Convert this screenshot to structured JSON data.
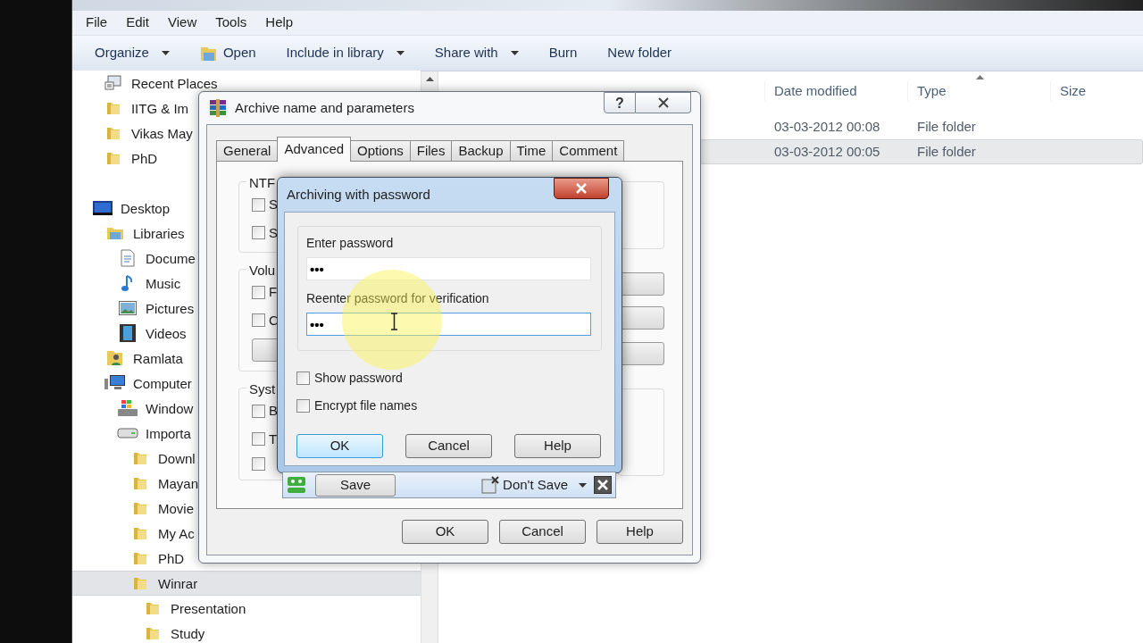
{
  "menu": [
    "File",
    "Edit",
    "View",
    "Tools",
    "Help"
  ],
  "toolbar": [
    {
      "label": "Organize",
      "kind": "dropdown"
    },
    {
      "label": "Open",
      "kind": "icon"
    },
    {
      "label": "Include in library",
      "kind": "dropdown"
    },
    {
      "label": "Share with",
      "kind": "dropdown"
    },
    {
      "label": "Burn",
      "kind": "plain"
    },
    {
      "label": "New folder",
      "kind": "plain"
    }
  ],
  "favorites": [
    {
      "label": "Recent Places",
      "kind": "recent",
      "selected": false
    },
    {
      "label": "IITG & Im",
      "kind": "folder",
      "selected": false
    },
    {
      "label": "Vikas May",
      "kind": "folder",
      "selected": false
    },
    {
      "label": "PhD",
      "kind": "folder",
      "selected": false
    }
  ],
  "tree": [
    {
      "label": "Desktop",
      "kind": "desktop",
      "selected": false,
      "children": [
        {
          "label": "Libraries",
          "kind": "libraries",
          "selected": false,
          "children": [
            {
              "label": "Docume",
              "kind": "document",
              "selected": false
            },
            {
              "label": "Music",
              "kind": "music",
              "selected": false
            },
            {
              "label": "Pictures",
              "kind": "pictures",
              "selected": false
            },
            {
              "label": "Videos",
              "kind": "videos",
              "selected": false
            }
          ]
        },
        {
          "label": "Ramlata",
          "kind": "user",
          "selected": false
        },
        {
          "label": "Computer",
          "kind": "computer",
          "selected": false,
          "children": [
            {
              "label": "Window",
              "kind": "windrive",
              "selected": false
            },
            {
              "label": "Importa",
              "kind": "drive",
              "selected": false,
              "children": [
                {
                  "label": "Downl",
                  "kind": "folder",
                  "selected": false
                },
                {
                  "label": "Mayan",
                  "kind": "folder",
                  "selected": false
                },
                {
                  "label": "Movie",
                  "kind": "folder",
                  "selected": false
                },
                {
                  "label": "My Ac",
                  "kind": "folder",
                  "selected": false
                },
                {
                  "label": "PhD",
                  "kind": "folder",
                  "selected": false
                },
                {
                  "label": "Winrar",
                  "kind": "folder",
                  "selected": true,
                  "children": [
                    {
                      "label": "Presentation",
                      "kind": "folder",
                      "selected": false
                    },
                    {
                      "label": "Study",
                      "kind": "folder",
                      "selected": false
                    }
                  ]
                }
              ]
            }
          ]
        }
      ]
    }
  ],
  "table": {
    "columns": [
      "Date modified",
      "Type",
      "Size"
    ],
    "rows": [
      {
        "date_modified": "03-03-2012 00:08",
        "type": "File folder",
        "selected": false
      },
      {
        "date_modified": "03-03-2012 00:05",
        "type": "File folder",
        "selected": true
      }
    ]
  },
  "archive_dialog": {
    "title": "Archive name and parameters",
    "help_button": "?",
    "tabs": [
      {
        "label": "General",
        "selected": false
      },
      {
        "label": "Advanced",
        "selected": true
      },
      {
        "label": "Options",
        "selected": false
      },
      {
        "label": "Files",
        "selected": false
      },
      {
        "label": "Backup",
        "selected": false
      },
      {
        "label": "Time",
        "selected": false
      },
      {
        "label": "Comment",
        "selected": false
      }
    ],
    "groups": [
      {
        "label": "NTF",
        "checkboxes": [
          {
            "label": "S",
            "checked": false
          },
          {
            "label": "S",
            "checked": false
          }
        ],
        "has_button": false
      },
      {
        "label": "Volu",
        "checkboxes": [
          {
            "label": "F",
            "checked": false
          },
          {
            "label": "C",
            "checked": false
          }
        ],
        "has_button": true
      },
      {
        "label": "Syst",
        "checkboxes": [
          {
            "label": "B",
            "checked": false
          },
          {
            "label": "T",
            "checked": false
          },
          {
            "checked": false
          }
        ],
        "has_button": false
      }
    ],
    "buttons": [
      "OK",
      "Cancel",
      "Help"
    ]
  },
  "password_dialog": {
    "title": "Archiving with password",
    "fields": [
      {
        "label": "Enter password",
        "value": "•••",
        "focused": false
      },
      {
        "label": "Reenter password for verification",
        "value": "•••",
        "focused": true
      }
    ],
    "checkboxes": [
      {
        "label": "Show password",
        "checked": false
      },
      {
        "label": "Encrypt file names",
        "checked": false
      }
    ],
    "buttons": [
      {
        "label": "OK",
        "default": true
      },
      {
        "label": "Cancel",
        "default": false
      },
      {
        "label": "Help",
        "default": false
      }
    ]
  },
  "save_bar": {
    "save": "Save",
    "dont_save": "Don't Save"
  }
}
